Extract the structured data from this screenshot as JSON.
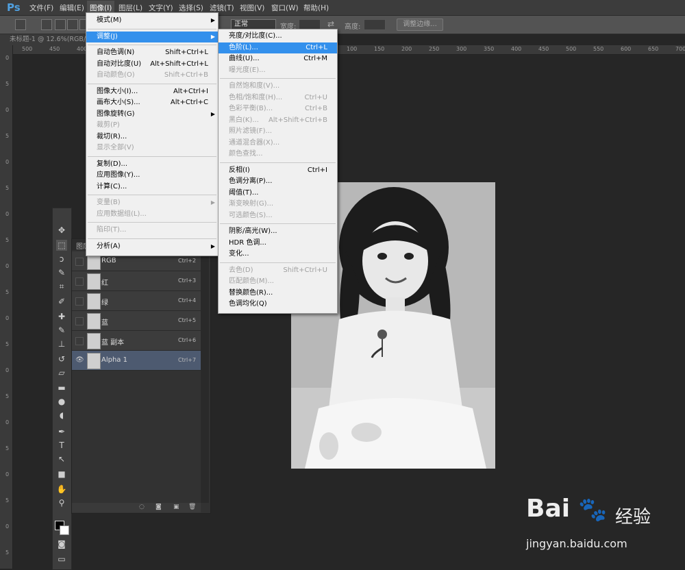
{
  "app": {
    "logo": "Ps"
  },
  "menubar": [
    "文件(F)",
    "编辑(E)",
    "图像(I)",
    "图层(L)",
    "文字(Y)",
    "选择(S)",
    "滤镜(T)",
    "视图(V)",
    "窗口(W)",
    "帮助(H)"
  ],
  "options": {
    "style_value": "正常",
    "width_label": "宽度:",
    "height_label": "高度:",
    "refine_button": "调整边缘..."
  },
  "doc_tab": "未标题-1 @ 12.6%(RGB/8",
  "ruler_h": [
    "500",
    "450",
    "400",
    "100",
    "150",
    "200",
    "250",
    "300",
    "350",
    "400",
    "450",
    "500",
    "550",
    "600",
    "650",
    "700"
  ],
  "ruler_v": [
    "0",
    "5",
    "0",
    "5",
    "0",
    "5",
    "0",
    "5",
    "0",
    "5",
    "0",
    "5",
    "0",
    "5",
    "0",
    "5",
    "0",
    "5",
    "0",
    "5"
  ],
  "image_menu": [
    {
      "label": "模式(M)",
      "sc": "",
      "sub": true,
      "dis": false
    },
    {
      "sep": true
    },
    {
      "label": "调整(J)",
      "sc": "",
      "sub": true,
      "dis": false,
      "hl": true
    },
    {
      "sep": true
    },
    {
      "label": "自动色调(N)",
      "sc": "Shift+Ctrl+L",
      "dis": false
    },
    {
      "label": "自动对比度(U)",
      "sc": "Alt+Shift+Ctrl+L",
      "dis": false
    },
    {
      "label": "自动颜色(O)",
      "sc": "Shift+Ctrl+B",
      "dis": true
    },
    {
      "sep": true
    },
    {
      "label": "图像大小(I)...",
      "sc": "Alt+Ctrl+I",
      "dis": false
    },
    {
      "label": "画布大小(S)...",
      "sc": "Alt+Ctrl+C",
      "dis": false
    },
    {
      "label": "图像旋转(G)",
      "sc": "",
      "sub": true,
      "dis": false
    },
    {
      "label": "裁剪(P)",
      "sc": "",
      "dis": true
    },
    {
      "label": "裁切(R)...",
      "sc": "",
      "dis": false
    },
    {
      "label": "显示全部(V)",
      "sc": "",
      "dis": true
    },
    {
      "sep": true
    },
    {
      "label": "复制(D)...",
      "sc": "",
      "dis": false
    },
    {
      "label": "应用图像(Y)...",
      "sc": "",
      "dis": false
    },
    {
      "label": "计算(C)...",
      "sc": "",
      "dis": false
    },
    {
      "sep": true
    },
    {
      "label": "变量(B)",
      "sc": "",
      "sub": true,
      "dis": true
    },
    {
      "label": "应用数据组(L)...",
      "sc": "",
      "dis": true
    },
    {
      "sep": true
    },
    {
      "label": "陷印(T)...",
      "sc": "",
      "dis": true
    },
    {
      "sep": true
    },
    {
      "label": "分析(A)",
      "sc": "",
      "sub": true,
      "dis": false
    }
  ],
  "adjust_menu": [
    {
      "label": "亮度/对比度(C)...",
      "sc": "",
      "dis": false
    },
    {
      "label": "色阶(L)...",
      "sc": "Ctrl+L",
      "dis": false,
      "hl": true
    },
    {
      "label": "曲线(U)...",
      "sc": "Ctrl+M",
      "dis": false
    },
    {
      "label": "曝光度(E)...",
      "sc": "",
      "dis": true
    },
    {
      "sep": true
    },
    {
      "label": "自然饱和度(V)...",
      "sc": "",
      "dis": true
    },
    {
      "label": "色相/饱和度(H)...",
      "sc": "Ctrl+U",
      "dis": true
    },
    {
      "label": "色彩平衡(B)...",
      "sc": "Ctrl+B",
      "dis": true
    },
    {
      "label": "黑白(K)...",
      "sc": "Alt+Shift+Ctrl+B",
      "dis": true
    },
    {
      "label": "照片滤镜(F)...",
      "sc": "",
      "dis": true
    },
    {
      "label": "通道混合器(X)...",
      "sc": "",
      "dis": true
    },
    {
      "label": "颜色查找...",
      "sc": "",
      "dis": true
    },
    {
      "sep": true
    },
    {
      "label": "反相(I)",
      "sc": "Ctrl+I",
      "dis": false
    },
    {
      "label": "色调分离(P)...",
      "sc": "",
      "dis": false
    },
    {
      "label": "阈值(T)...",
      "sc": "",
      "dis": false
    },
    {
      "label": "渐变映射(G)...",
      "sc": "",
      "dis": true
    },
    {
      "label": "可选颜色(S)...",
      "sc": "",
      "dis": true
    },
    {
      "sep": true
    },
    {
      "label": "阴影/高光(W)...",
      "sc": "",
      "dis": false
    },
    {
      "label": "HDR 色调...",
      "sc": "",
      "dis": false
    },
    {
      "label": "变化...",
      "sc": "",
      "dis": false
    },
    {
      "sep": true
    },
    {
      "label": "去色(D)",
      "sc": "Shift+Ctrl+U",
      "dis": true
    },
    {
      "label": "匹配颜色(M)...",
      "sc": "",
      "dis": true
    },
    {
      "label": "替换颜色(R)...",
      "sc": "",
      "dis": false
    },
    {
      "label": "色调均化(Q)",
      "sc": "",
      "dis": false
    }
  ],
  "channels": {
    "tab_label": "图层",
    "rows": [
      {
        "name": "RGB",
        "key": "Ctrl+2"
      },
      {
        "name": "红",
        "key": "Ctrl+3"
      },
      {
        "name": "绿",
        "key": "Ctrl+4"
      },
      {
        "name": "蓝",
        "key": "Ctrl+5"
      },
      {
        "name": "蓝 副本",
        "key": "Ctrl+6"
      },
      {
        "name": "Alpha 1",
        "key": "Ctrl+7",
        "selected": true
      }
    ]
  },
  "watermark": {
    "brand": "Bai",
    "product": "经验",
    "url": "jingyan.baidu.com"
  },
  "colors": {
    "highlight": "#3390ec",
    "menubar": "#3c3c3c",
    "workspace": "#262626"
  }
}
